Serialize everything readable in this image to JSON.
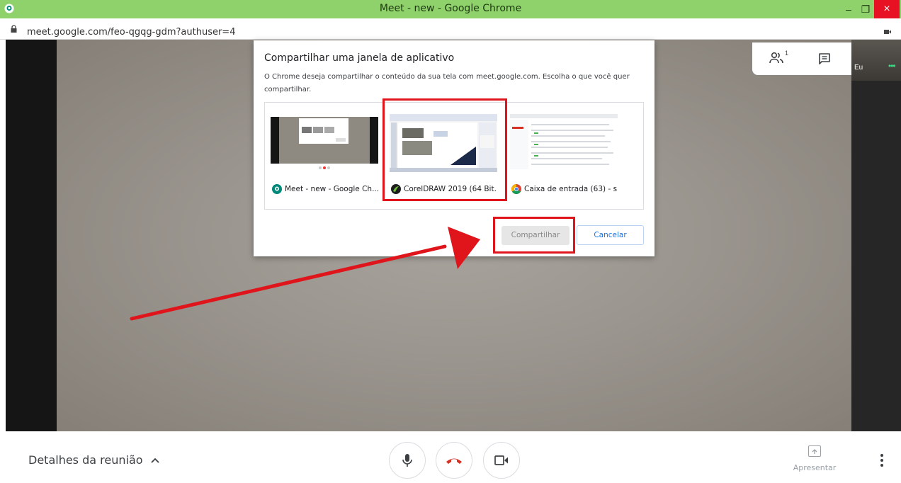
{
  "window": {
    "title": "Meet - new - Google Chrome",
    "minimize_glyph": "–",
    "maximize_glyph": "❐",
    "close_glyph": "×",
    "accent": "#8fd16a",
    "close_color": "#e81123"
  },
  "address_bar": {
    "url": "meet.google.com/feo-qgqg-gdm?authuser=4"
  },
  "meet_panel": {
    "people_count": "1",
    "self_label": "Eu",
    "self_more": "•••"
  },
  "dialog": {
    "title": "Compartilhar uma janela de aplicativo",
    "description": "O Chrome deseja compartilhar o conteúdo da sua tela com meet.google.com. Escolha o que você quer compartilhar.",
    "sources": [
      {
        "label": "Meet - new - Google Ch...",
        "icon": "google-meet-icon"
      },
      {
        "label": "CorelDRAW 2019 (64 Bit...",
        "icon": "coreldraw-icon"
      },
      {
        "label": "Caixa de entrada (63) - s...",
        "icon": "chrome-icon"
      }
    ],
    "share_label": "Compartilhar",
    "cancel_label": "Cancelar"
  },
  "annotation": {
    "highlight_color": "#e0151c"
  },
  "bottom_bar": {
    "details_label": "Detalhes da reunião",
    "present_label": "Apresentar"
  }
}
